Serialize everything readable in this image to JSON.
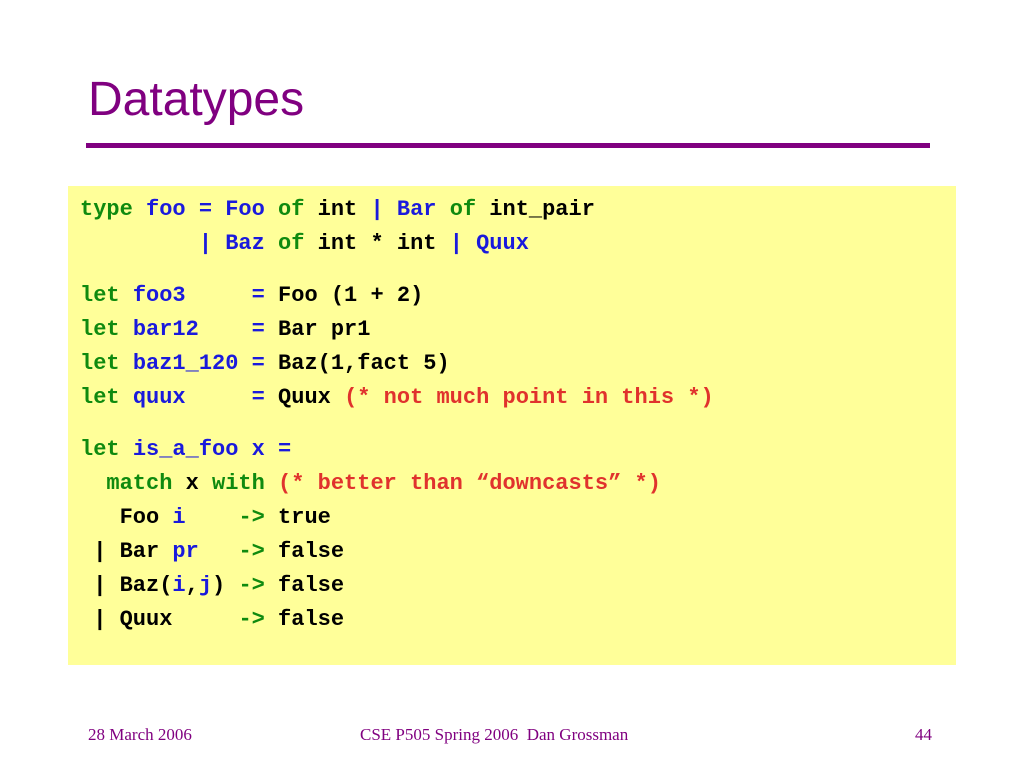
{
  "slide": {
    "title": "Datatypes",
    "footer": {
      "date": "28 March 2006",
      "course": "CSE P505 Spring 2006  Dan Grossman",
      "page": "44"
    }
  },
  "colors": {
    "title": "#800080",
    "rule": "#800080",
    "code_background": "#ffff99",
    "keyword": "#0f8a0f",
    "identifier": "#1a1adc",
    "plain": "#000000",
    "comment": "#e0322d"
  },
  "code": [
    {
      "gap": false,
      "segs": [
        {
          "t": "type ",
          "c": "kw"
        },
        {
          "t": "foo = Foo ",
          "c": "id"
        },
        {
          "t": "of ",
          "c": "kw"
        },
        {
          "t": "int ",
          "c": "tx"
        },
        {
          "t": "| Bar ",
          "c": "id"
        },
        {
          "t": "of ",
          "c": "kw"
        },
        {
          "t": "int_pair",
          "c": "tx"
        }
      ]
    },
    {
      "gap": false,
      "segs": [
        {
          "t": "         | Baz ",
          "c": "id"
        },
        {
          "t": "of ",
          "c": "kw"
        },
        {
          "t": "int * int ",
          "c": "tx"
        },
        {
          "t": "| Quux",
          "c": "id"
        }
      ]
    },
    {
      "gap": true,
      "segs": [
        {
          "t": "let ",
          "c": "kw"
        },
        {
          "t": "foo3     = ",
          "c": "id"
        },
        {
          "t": "Foo (1 + 2)",
          "c": "tx"
        }
      ]
    },
    {
      "gap": false,
      "segs": [
        {
          "t": "let ",
          "c": "kw"
        },
        {
          "t": "bar12    = ",
          "c": "id"
        },
        {
          "t": "Bar pr1",
          "c": "tx"
        }
      ]
    },
    {
      "gap": false,
      "segs": [
        {
          "t": "let ",
          "c": "kw"
        },
        {
          "t": "baz1_120 = ",
          "c": "id"
        },
        {
          "t": "Baz(1,fact 5)",
          "c": "tx"
        }
      ]
    },
    {
      "gap": false,
      "segs": [
        {
          "t": "let ",
          "c": "kw"
        },
        {
          "t": "quux     = ",
          "c": "id"
        },
        {
          "t": "Quux ",
          "c": "tx"
        },
        {
          "t": "(* not much point in this *)",
          "c": "cm"
        }
      ]
    },
    {
      "gap": true,
      "segs": [
        {
          "t": "let ",
          "c": "kw"
        },
        {
          "t": "is_a_foo x =",
          "c": "id"
        }
      ]
    },
    {
      "gap": false,
      "segs": [
        {
          "t": "  match ",
          "c": "kw"
        },
        {
          "t": "x ",
          "c": "tx"
        },
        {
          "t": "with ",
          "c": "kw"
        },
        {
          "t": "(* better than “downcasts” *)",
          "c": "cm"
        }
      ]
    },
    {
      "gap": false,
      "segs": [
        {
          "t": "   Foo ",
          "c": "tx"
        },
        {
          "t": "i    ",
          "c": "id"
        },
        {
          "t": "-> ",
          "c": "kw"
        },
        {
          "t": "true",
          "c": "tx"
        }
      ]
    },
    {
      "gap": false,
      "segs": [
        {
          "t": " | Bar ",
          "c": "tx"
        },
        {
          "t": "pr   ",
          "c": "id"
        },
        {
          "t": "-> ",
          "c": "kw"
        },
        {
          "t": "false",
          "c": "tx"
        }
      ]
    },
    {
      "gap": false,
      "segs": [
        {
          "t": " | Baz(",
          "c": "tx"
        },
        {
          "t": "i",
          "c": "id"
        },
        {
          "t": ",",
          "c": "tx"
        },
        {
          "t": "j",
          "c": "id"
        },
        {
          "t": ") ",
          "c": "tx"
        },
        {
          "t": "-> ",
          "c": "kw"
        },
        {
          "t": "false",
          "c": "tx"
        }
      ]
    },
    {
      "gap": false,
      "segs": [
        {
          "t": " | Quux     ",
          "c": "tx"
        },
        {
          "t": "-> ",
          "c": "kw"
        },
        {
          "t": "false",
          "c": "tx"
        }
      ]
    }
  ]
}
